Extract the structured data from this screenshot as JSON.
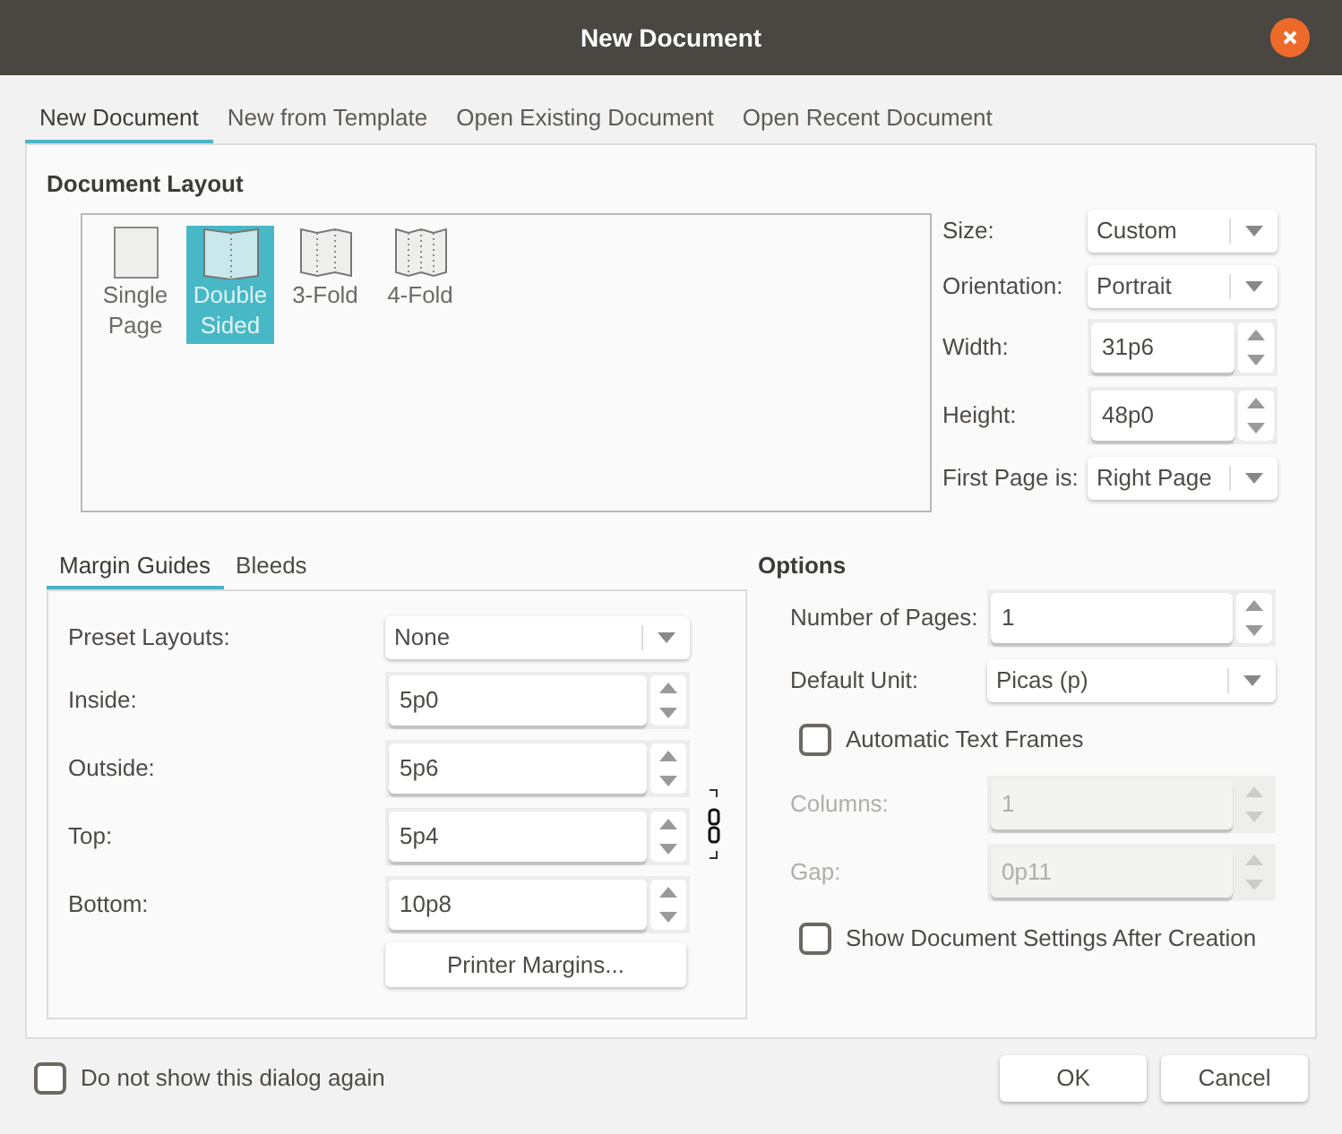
{
  "window": {
    "title": "New Document"
  },
  "tabs": [
    {
      "label": "New Document",
      "selected": true
    },
    {
      "label": "New from Template",
      "selected": false
    },
    {
      "label": "Open Existing Document",
      "selected": false
    },
    {
      "label": "Open Recent Document",
      "selected": false
    }
  ],
  "document_layout": {
    "title": "Document Layout",
    "layouts": [
      {
        "kind": "single",
        "label": "Single Page",
        "selected": false
      },
      {
        "kind": "double",
        "label": "Double Sided",
        "selected": true
      },
      {
        "kind": "fold3",
        "label": "3-Fold",
        "selected": false
      },
      {
        "kind": "fold4",
        "label": "4-Fold",
        "selected": false
      }
    ],
    "fields": [
      {
        "kind": "select",
        "label": "Size:",
        "value": "Custom"
      },
      {
        "kind": "select",
        "label": "Orientation:",
        "value": "Portrait"
      },
      {
        "kind": "spin",
        "label": "Width:",
        "value": "31p6"
      },
      {
        "kind": "spin",
        "label": "Height:",
        "value": "48p0"
      },
      {
        "kind": "select",
        "label": "First Page is:",
        "value": "Right Page"
      }
    ]
  },
  "margin_tabs": [
    {
      "label": "Margin Guides",
      "selected": true
    },
    {
      "label": "Bleeds",
      "selected": false
    }
  ],
  "margin_fields": [
    {
      "kind": "select",
      "label": "Preset Layouts:",
      "value": "None"
    },
    {
      "kind": "spin",
      "label": "Inside:",
      "value": "5p0"
    },
    {
      "kind": "spin",
      "label": "Outside:",
      "value": "5p6"
    },
    {
      "kind": "spin",
      "label": "Top:",
      "value": "5p4"
    },
    {
      "kind": "spin",
      "label": "Bottom:",
      "value": "10p8"
    }
  ],
  "printer_margins_button": "Printer Margins...",
  "options": {
    "title": "Options",
    "fields": [
      {
        "kind": "spin",
        "label": "Number of Pages:",
        "value": "1",
        "disabled": false
      },
      {
        "kind": "select",
        "label": "Default Unit:",
        "value": "Picas (p)",
        "disabled": false
      },
      {
        "kind": "checkbox",
        "label": "Automatic Text Frames",
        "checked": false,
        "disabled": false
      },
      {
        "kind": "spin",
        "label": "Columns:",
        "value": "1",
        "disabled": true
      },
      {
        "kind": "spin",
        "label": "Gap:",
        "value": "0p11",
        "disabled": true
      },
      {
        "kind": "checkbox",
        "label": "Show Document Settings After Creation",
        "checked": false,
        "disabled": false
      }
    ]
  },
  "footer": {
    "checkbox": {
      "label": "Do not show this dialog again",
      "checked": false
    },
    "buttons": [
      "OK",
      "Cancel"
    ]
  }
}
